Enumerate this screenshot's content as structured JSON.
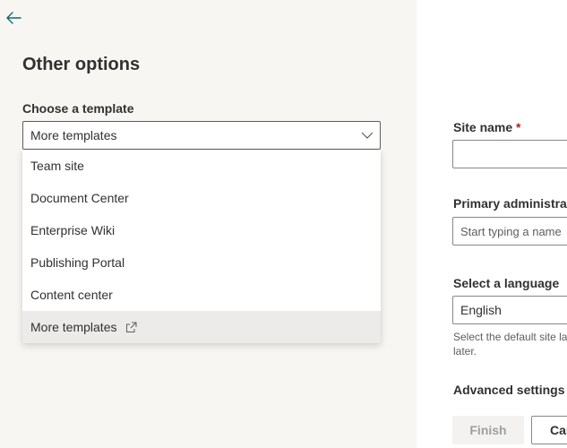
{
  "icons": {
    "back": "back-arrow-icon",
    "chevron": "chevron-down-icon",
    "external": "external-link-icon"
  },
  "colors": {
    "accent": "#0b6a6f",
    "panel_bg": "#f8f6f3",
    "selected_bg": "#edebe9",
    "required": "#a4262c"
  },
  "left": {
    "title": "Other options",
    "template_label": "Choose a template",
    "template_value": "More templates",
    "options": [
      {
        "label": "Team site"
      },
      {
        "label": "Document Center"
      },
      {
        "label": "Enterprise Wiki"
      },
      {
        "label": "Publishing Portal"
      },
      {
        "label": "Content center"
      },
      {
        "label": "More templates"
      }
    ]
  },
  "right": {
    "site_name_label": "Site name",
    "required_mark": " *",
    "site_name_value": "",
    "admin_label": "Primary administrator",
    "admin_placeholder": "Start typing a name",
    "language_label": "Select a language",
    "language_value": "English",
    "language_help_line1": "Select the default site language",
    "language_help_line2": "later.",
    "advanced_label": "Advanced settings",
    "finish_label": "Finish",
    "cancel_label": "Cancel"
  }
}
